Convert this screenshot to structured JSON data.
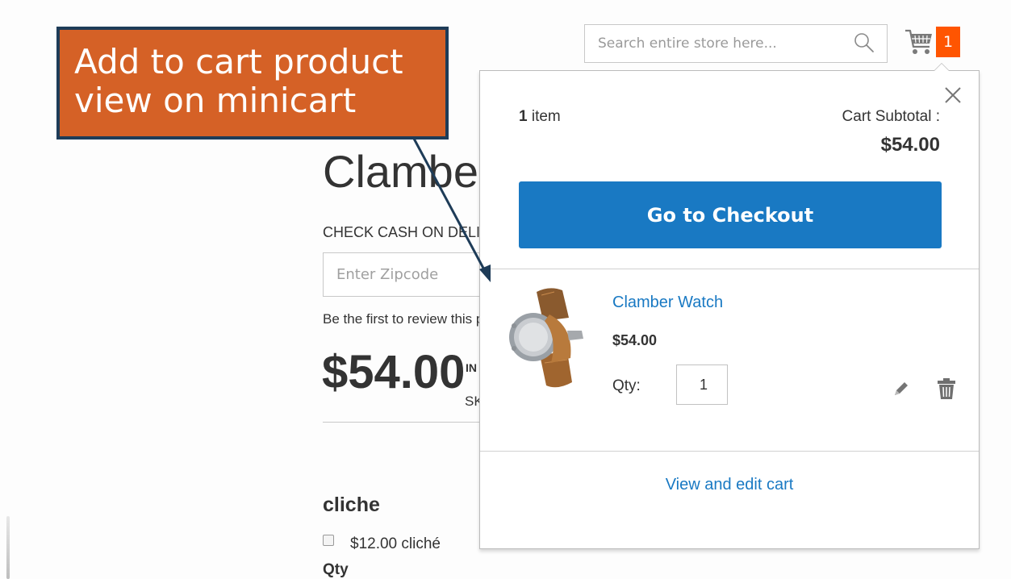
{
  "header": {
    "search_placeholder": "Search entire store here...",
    "cart_count": "1"
  },
  "product": {
    "title": "Clamber Watch",
    "check_cod_label": "CHECK CASH ON DELIVERY",
    "zip_placeholder": "Enter Zipcode",
    "review_text": "Be the first to review this product",
    "price": "$54.00",
    "price_sup": "IN STOCK",
    "price_sub": "SKU",
    "option_title": "cliche",
    "option_label": "$12.00 cliché",
    "qty_label": "Qty"
  },
  "minicart": {
    "items_count_number": "1",
    "items_count_word": "item",
    "subtotal_label": "Cart Subtotal :",
    "subtotal_value": "$54.00",
    "checkout_label": "Go to Checkout",
    "item": {
      "name": "Clamber Watch",
      "price": "$54.00",
      "qty_label": "Qty:",
      "qty_value": "1"
    },
    "view_cart_label": "View and edit cart"
  },
  "annotation": {
    "text": "Add to cart product view on minicart"
  },
  "colors": {
    "accent_blue": "#1979c3",
    "badge_orange": "#ff5501",
    "callout_fill": "#d56126",
    "callout_border": "#1e3c58"
  },
  "icons": [
    "search-icon",
    "cart-icon",
    "close-icon",
    "edit-icon",
    "trash-icon"
  ]
}
